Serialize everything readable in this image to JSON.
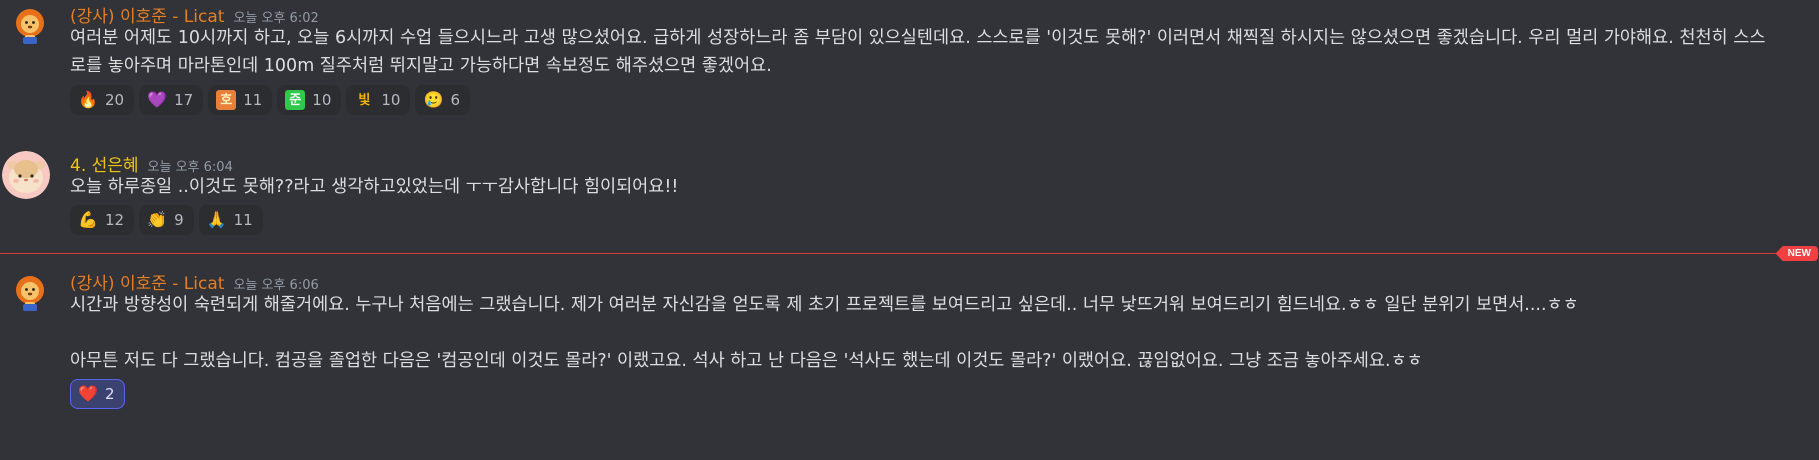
{
  "messages": [
    {
      "author": "(강사) 이호준 - Licat",
      "time": "오늘 오후 6:02",
      "text": "여러분 어제도 10시까지 하고, 오늘 6시까지 수업 들으시느라 고생 많으셨어요. 급하게 성장하느라 좀 부담이 있으실텐데요. 스스로를 '이것도 못해?' 이러면서 채찍질 하시지는 않으셨으면 좋겠습니다. 우리 멀리 가야해요. 천천히 스스로를 놓아주며 마라톤인데 100m 질주처럼 뛰지말고 가능하다면 속보정도 해주셨으면 좋겠어요.",
      "reactions": [
        {
          "emoji": "🔥",
          "count": "20"
        },
        {
          "emoji": "💜",
          "count": "17"
        },
        {
          "emoji": "호",
          "count": "11"
        },
        {
          "emoji": "준",
          "count": "10"
        },
        {
          "emoji": "빛",
          "count": "10"
        },
        {
          "emoji": "🥲",
          "count": "6"
        }
      ]
    },
    {
      "author": "4. 선은혜",
      "time": "오늘 오후 6:04",
      "text": "오늘 하루종일 ..이것도 못해??라고 생각하고있었는데 ㅜㅜ감사합니다 힘이되어요!!",
      "reactions": [
        {
          "emoji": "💪",
          "count": "12"
        },
        {
          "emoji": "👏",
          "count": "9"
        },
        {
          "emoji": "🙏",
          "count": "11"
        }
      ]
    },
    {
      "author": "(강사) 이호준 - Licat",
      "time": "오늘 오후 6:06",
      "text": "시간과 방향성이 숙련되게 해줄거에요. 누구나 처음에는 그랬습니다. 제가 여러분 자신감을 얻도록 제 초기 프로젝트를 보여드리고 싶은데.. 너무 낯뜨거워 보여드리기 힘드네요.ㅎㅎ 일단 분위기 보면서....ㅎㅎ",
      "text2": "아무튼 저도 다 그랬습니다. 컴공을 졸업한 다음은 '컴공인데 이것도 몰라?' 이랬고요. 석사 하고 난 다음은 '석사도 했는데 이것도 몰라?' 이랬어요. 끊임없어요. 그냥 조금 놓아주세요.ㅎㅎ",
      "reactions": [
        {
          "emoji": "❤️",
          "count": "2"
        }
      ]
    }
  ],
  "new_badge": "NEW",
  "colors": {
    "background": "#313338",
    "instructor_name": "#e67e22",
    "student_name": "#f1c40f",
    "divider": "#f23f42"
  }
}
